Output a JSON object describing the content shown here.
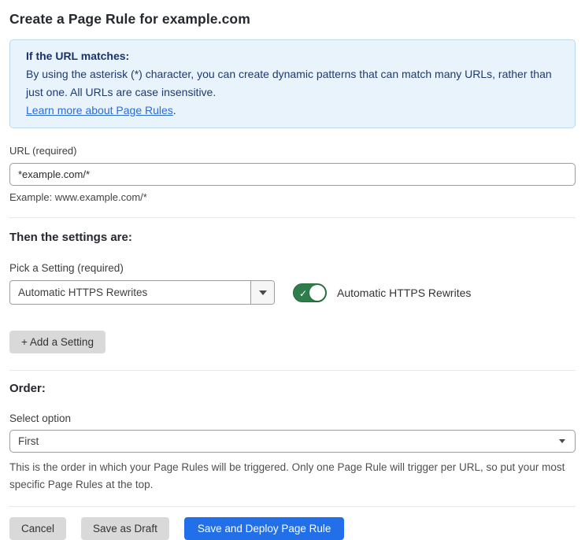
{
  "page": {
    "title": "Create a Page Rule for example.com"
  },
  "info_box": {
    "heading": "If the URL matches:",
    "body": "By using the asterisk (*) character, you can create dynamic patterns that can match many URLs, rather than just one. All URLs are case insensitive.",
    "link_text": "Learn more about Page Rules",
    "link_suffix": "."
  },
  "url_section": {
    "label": "URL (required)",
    "value": "*example.com/*",
    "example": "Example: www.example.com/*"
  },
  "settings_section": {
    "heading": "Then the settings are:",
    "pick_label": "Pick a Setting (required)",
    "selected_setting": "Automatic HTTPS Rewrites",
    "toggle_state": "on",
    "toggle_check": "✓",
    "toggle_label": "Automatic HTTPS Rewrites",
    "add_button_label": "+ Add a Setting"
  },
  "order_section": {
    "heading": "Order:",
    "label": "Select option",
    "selected_option": "First",
    "help": "This is the order in which your Page Rules will be triggered. Only one Page Rule will trigger per URL, so put your most specific Page Rules at the top."
  },
  "footer": {
    "cancel_label": "Cancel",
    "save_draft_label": "Save as Draft",
    "save_deploy_label": "Save and Deploy Page Rule"
  },
  "colors": {
    "primary_blue": "#2170ea",
    "toggle_green": "#2e7d4a",
    "info_background": "#e9f3fc",
    "info_border": "#b9d9f3",
    "info_text": "#1e3a6e",
    "link_blue": "#2b6bd9"
  }
}
